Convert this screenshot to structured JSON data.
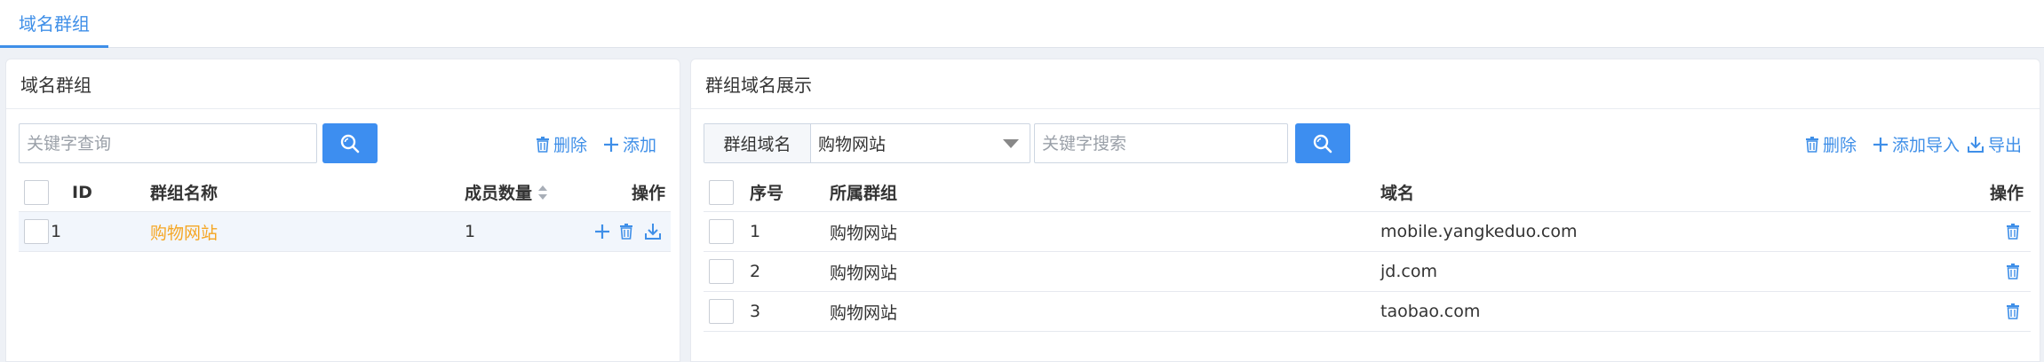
{
  "tabs": [
    {
      "label": "域名群组",
      "active": true
    }
  ],
  "left": {
    "title": "域名群组",
    "search_placeholder": "关键字查询",
    "actions": {
      "delete": "删除",
      "add": "添加"
    },
    "columns": {
      "id": "ID",
      "name": "群组名称",
      "members": "成员数量",
      "ops": "操作"
    },
    "rows": [
      {
        "id": "1",
        "name": "购物网站",
        "members": "1"
      }
    ]
  },
  "right": {
    "title": "群组域名展示",
    "select_label": "群组域名",
    "select_value": "购物网站",
    "search_placeholder": "关键字搜索",
    "actions": {
      "delete": "删除",
      "import": "添加导入",
      "export": "导出"
    },
    "columns": {
      "index": "序号",
      "group": "所属群组",
      "domain": "域名",
      "ops": "操作"
    },
    "rows": [
      {
        "index": "1",
        "group": "购物网站",
        "domain": "mobile.yangkeduo.com"
      },
      {
        "index": "2",
        "group": "购物网站",
        "domain": "jd.com"
      },
      {
        "index": "3",
        "group": "购物网站",
        "domain": "taobao.com"
      }
    ]
  },
  "colors": {
    "accent": "#3f8fe8",
    "link": "#f5a623",
    "button": "#3d8ef0"
  }
}
